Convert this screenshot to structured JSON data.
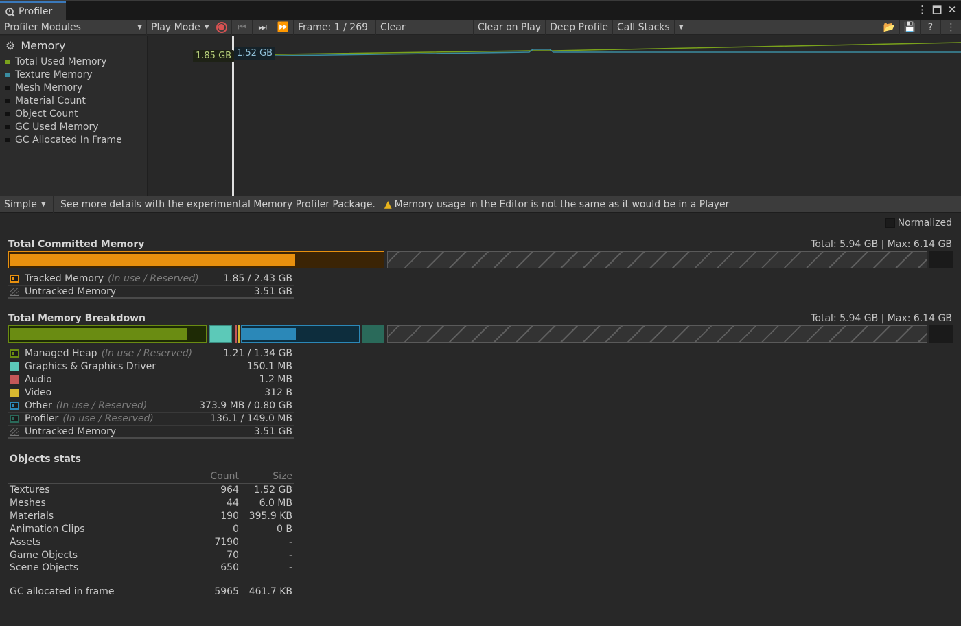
{
  "window": {
    "tab_title": "Profiler",
    "more_icon": "kebab-icon",
    "maximize_icon": "maximize-icon",
    "close_icon": "close-icon"
  },
  "toolbar": {
    "modules_label": "Profiler Modules",
    "play_mode_label": "Play Mode",
    "frame_label": "Frame: 1 / 269",
    "clear_label": "Clear",
    "clear_on_play_label": "Clear on Play",
    "deep_profile_label": "Deep Profile",
    "call_stacks_label": "Call Stacks"
  },
  "modules": {
    "title": "Memory",
    "items": [
      {
        "label": "Total Used Memory",
        "color": "#7aa21c"
      },
      {
        "label": "Texture Memory",
        "color": "#3a8ca0"
      },
      {
        "label": "Mesh Memory",
        "color": "#101010"
      },
      {
        "label": "Material Count",
        "color": "#101010"
      },
      {
        "label": "Object Count",
        "color": "#101010"
      },
      {
        "label": "GC Used Memory",
        "color": "#101010"
      },
      {
        "label": "GC Allocated In Frame",
        "color": "#101010"
      }
    ]
  },
  "graph": {
    "total_used_label": "1.85 GB",
    "texture_label": "1.52 GB"
  },
  "details_bar": {
    "view_mode": "Simple",
    "package_hint": "See more details with the experimental Memory Profiler Package.",
    "warning": "Memory usage in the Editor is not the same as it would be in a Player"
  },
  "details": {
    "normalized_label": "Normalized",
    "committed": {
      "title": "Total Committed Memory",
      "total": "Total: 5.94 GB | Max: 6.14 GB",
      "rows": [
        {
          "name": "Tracked Memory",
          "hint": "(In use / Reserved)",
          "value": "1.85 / 2.43 GB",
          "color": "#e8900e"
        },
        {
          "name": "Untracked Memory",
          "hint": "",
          "value": "3.51 GB",
          "color": "#555555"
        }
      ]
    },
    "breakdown": {
      "title": "Total Memory Breakdown",
      "total": "Total: 5.94 GB | Max: 6.14 GB",
      "rows": [
        {
          "name": "Managed Heap",
          "hint": "(In use / Reserved)",
          "value": "1.21 / 1.34 GB",
          "color": "#6a8c12"
        },
        {
          "name": "Graphics & Graphics Driver",
          "hint": "",
          "value": "150.1 MB",
          "color": "#5cc9b8"
        },
        {
          "name": "Audio",
          "hint": "",
          "value": "1.2 MB",
          "color": "#c45858"
        },
        {
          "name": "Video",
          "hint": "",
          "value": "312 B",
          "color": "#d8b830"
        },
        {
          "name": "Other",
          "hint": "(In use / Reserved)",
          "value": "373.9 MB / 0.80 GB",
          "color": "#2b88b8"
        },
        {
          "name": "Profiler",
          "hint": "(In use / Reserved)",
          "value": "136.1 / 149.0 MB",
          "color": "#2a6a5a"
        },
        {
          "name": "Untracked Memory",
          "hint": "",
          "value": "3.51 GB",
          "color": "#555555"
        }
      ]
    },
    "objects": {
      "title": "Objects stats",
      "col_count": "Count",
      "col_size": "Size",
      "rows": [
        {
          "name": "Textures",
          "count": "964",
          "size": "1.52 GB"
        },
        {
          "name": "Meshes",
          "count": "44",
          "size": "6.0 MB"
        },
        {
          "name": "Materials",
          "count": "190",
          "size": "395.9 KB"
        },
        {
          "name": "Animation Clips",
          "count": "0",
          "size": "0 B"
        },
        {
          "name": "Assets",
          "count": "7190",
          "size": "-"
        },
        {
          "name": "Game Objects",
          "count": "70",
          "size": "-"
        },
        {
          "name": "Scene Objects",
          "count": "650",
          "size": "-"
        }
      ],
      "gc": {
        "name": "GC allocated in frame",
        "count": "5965",
        "size": "461.7 KB"
      }
    }
  }
}
